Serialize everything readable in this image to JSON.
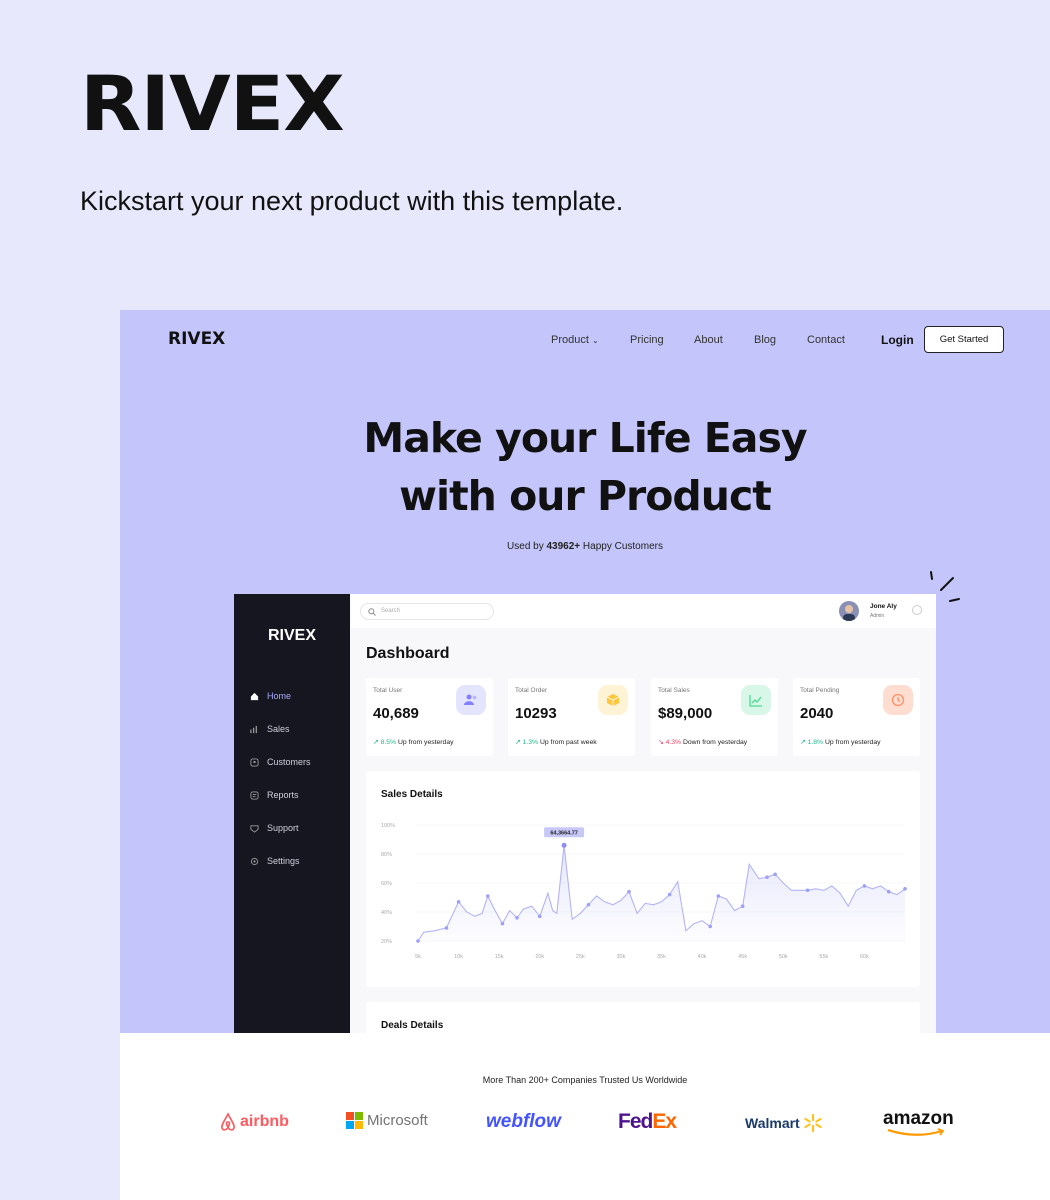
{
  "brand": "RIVEX",
  "tagline": "Kickstart your next product with this template.",
  "site": {
    "logo": "RIVEX",
    "nav": [
      "Product",
      "Pricing",
      "About",
      "Blog",
      "Contact"
    ],
    "login": "Login",
    "cta": "Get Started",
    "headline_line1": "Make your Life Easy",
    "headline_line2": "with our Product",
    "used_prefix": "Used by ",
    "used_count": "43962+",
    "used_suffix": " Happy Customers"
  },
  "dashboard": {
    "logo": "RIVEX",
    "menu": [
      "Home",
      "Sales",
      "Customers",
      "Reports",
      "Support",
      "Settings"
    ],
    "search_placeholder": "Search",
    "user_name": "Jone Aly",
    "user_role": "Admin",
    "title": "Dashboard",
    "cards": [
      {
        "label": "Total User",
        "value": "40,689",
        "pct": "8.5%",
        "text": " Up from yesterday",
        "dir": "up",
        "icon": "users-icon",
        "bg": "#e5e4ff",
        "fg": "#8280ff"
      },
      {
        "label": "Total Order",
        "value": "10293",
        "pct": "1.3%",
        "text": " Up from past week",
        "dir": "up",
        "icon": "box-icon",
        "bg": "#fff3d6",
        "fg": "#fec53d"
      },
      {
        "label": "Total Sales",
        "value": "$89,000",
        "pct": "4.3%",
        "text": " Down from yesterday",
        "dir": "down",
        "icon": "line-chart-icon",
        "bg": "#d9f7e8",
        "fg": "#4ad991"
      },
      {
        "label": "Total Pending",
        "value": "2040",
        "pct": "1.8%",
        "text": " Up from yesterday",
        "dir": "up",
        "icon": "history-icon",
        "bg": "#ffded1",
        "fg": "#ff9066"
      }
    ],
    "sales_title": "Sales Details",
    "deals_title": "Deals Details"
  },
  "chart_data": {
    "type": "area",
    "title": "Sales Details",
    "x_ticks": [
      "5k",
      "10k",
      "15k",
      "20k",
      "25k",
      "30k",
      "35k",
      "40k",
      "45k",
      "50k",
      "55k",
      "60k"
    ],
    "y_ticks": [
      "20%",
      "40%",
      "60%",
      "80%",
      "100%"
    ],
    "ylim": [
      20,
      100
    ],
    "xlim": [
      5,
      65
    ],
    "points": [
      [
        5,
        20
      ],
      [
        5.7,
        26
      ],
      [
        7,
        27
      ],
      [
        8.5,
        29
      ],
      [
        10,
        47
      ],
      [
        11,
        40
      ],
      [
        12,
        37
      ],
      [
        12.9,
        39
      ],
      [
        13.6,
        51
      ],
      [
        14.5,
        41
      ],
      [
        15.4,
        32
      ],
      [
        16.3,
        41
      ],
      [
        17.2,
        36
      ],
      [
        18,
        42
      ],
      [
        19,
        44
      ],
      [
        20,
        37
      ],
      [
        21,
        53
      ],
      [
        21.6,
        41
      ],
      [
        22.1,
        39
      ],
      [
        23,
        86
      ],
      [
        24,
        35
      ],
      [
        25,
        39
      ],
      [
        26,
        45
      ],
      [
        27,
        51
      ],
      [
        28,
        47
      ],
      [
        29,
        45
      ],
      [
        30,
        48
      ],
      [
        31,
        54
      ],
      [
        32,
        39
      ],
      [
        33,
        46
      ],
      [
        34,
        45
      ],
      [
        35,
        47
      ],
      [
        36,
        52
      ],
      [
        37,
        61
      ],
      [
        38,
        27
      ],
      [
        39,
        32
      ],
      [
        40,
        34
      ],
      [
        41,
        30
      ],
      [
        42,
        51
      ],
      [
        43,
        49
      ],
      [
        44,
        41
      ],
      [
        45,
        44
      ],
      [
        45.8,
        73
      ],
      [
        47,
        63
      ],
      [
        48,
        64
      ],
      [
        49,
        66
      ],
      [
        50,
        60
      ],
      [
        51,
        55
      ],
      [
        52,
        55
      ],
      [
        53,
        55
      ],
      [
        54,
        56
      ],
      [
        55,
        55
      ],
      [
        56,
        58
      ],
      [
        57,
        53
      ],
      [
        58,
        44
      ],
      [
        59,
        55
      ],
      [
        60,
        58
      ],
      [
        61,
        56
      ],
      [
        62,
        58
      ],
      [
        63,
        54
      ],
      [
        64,
        52
      ],
      [
        65,
        56
      ]
    ],
    "highlight": {
      "label": "64,3664.77"
    },
    "markers": [
      0,
      3,
      4,
      8,
      10,
      12,
      15,
      19,
      22,
      27,
      32,
      37,
      38,
      41,
      44,
      45,
      49,
      56,
      59,
      61
    ]
  },
  "trusted_text": "More Than 200+ Companies Trusted Us Worldwide",
  "partners": [
    "airbnb",
    "Microsoft",
    "webflow",
    "FedEx",
    "Walmart",
    "amazon"
  ]
}
